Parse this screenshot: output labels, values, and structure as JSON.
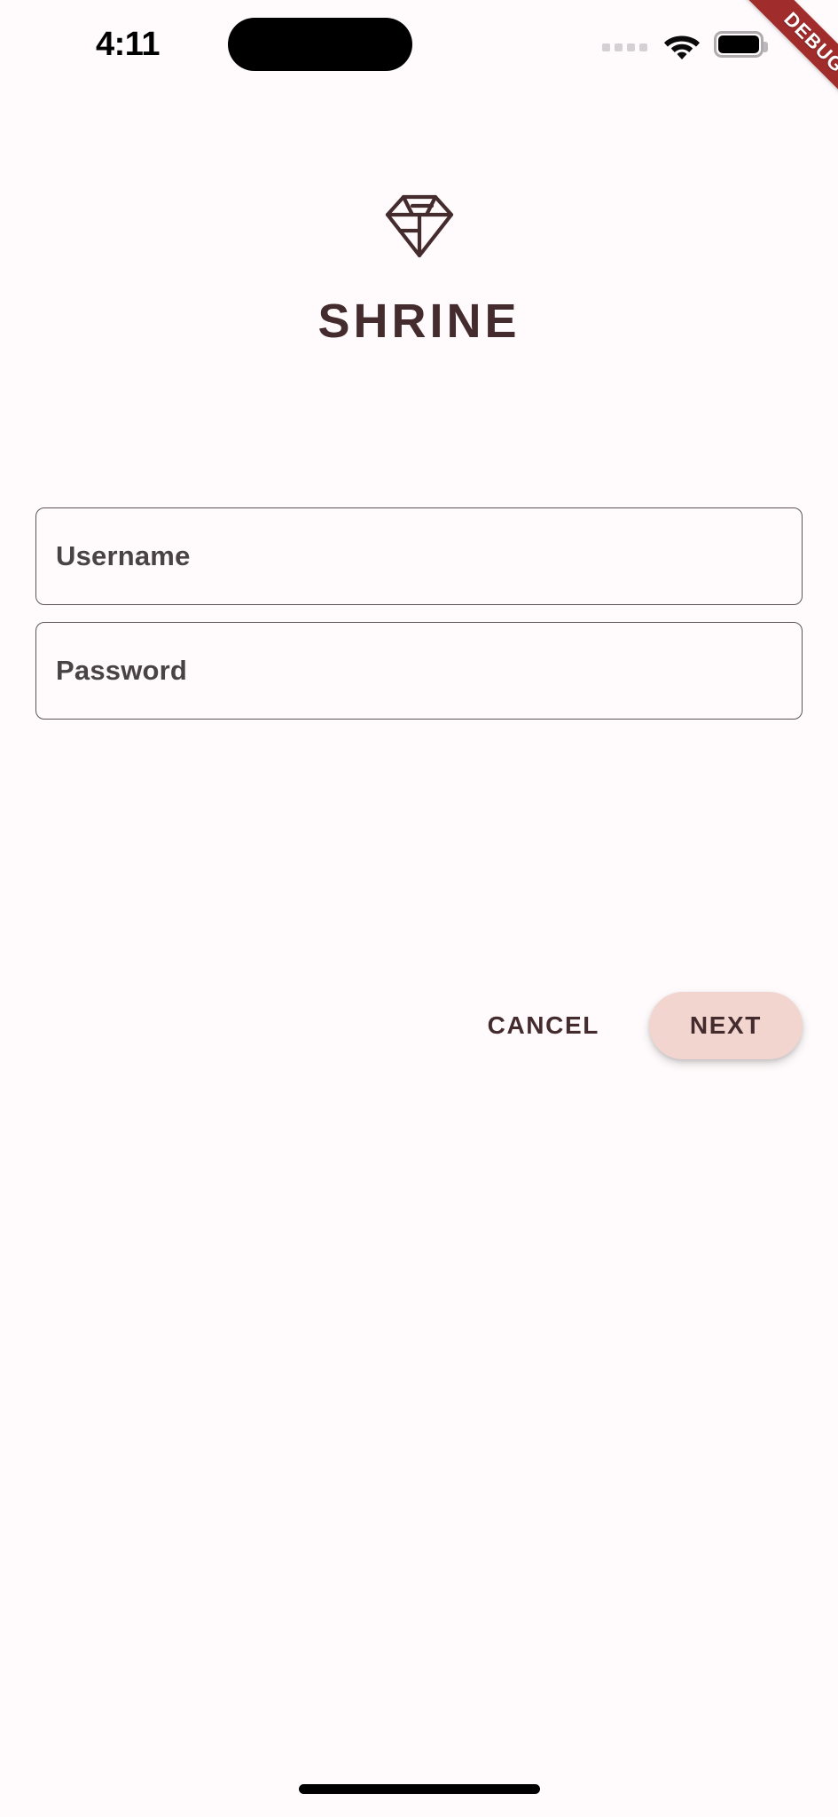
{
  "meta": {
    "screen_background": "#FFFBFC",
    "brand_color": "#442C2E",
    "accent_color": "#F2D5CE",
    "field_border_color": "#5F5358"
  },
  "status_bar": {
    "time": "4:11",
    "icons": {
      "cellular": "cellular-dots-icon",
      "wifi": "wifi-icon",
      "battery": "battery-icon"
    }
  },
  "debug_banner": {
    "label": "DEBUG",
    "color": "#A02C2C",
    "text_color": "#FFFFFF"
  },
  "brand": {
    "logo_name": "shrine-diamond-logo",
    "title": "SHRINE"
  },
  "form": {
    "fields": [
      {
        "name": "username",
        "label": "Username",
        "value": "",
        "placeholder": "Username"
      },
      {
        "name": "password",
        "label": "Password",
        "value": "",
        "placeholder": "Password"
      }
    ]
  },
  "actions": {
    "cancel_label": "CANCEL",
    "next_label": "NEXT"
  },
  "home_indicator": {
    "name": "home-indicator"
  }
}
